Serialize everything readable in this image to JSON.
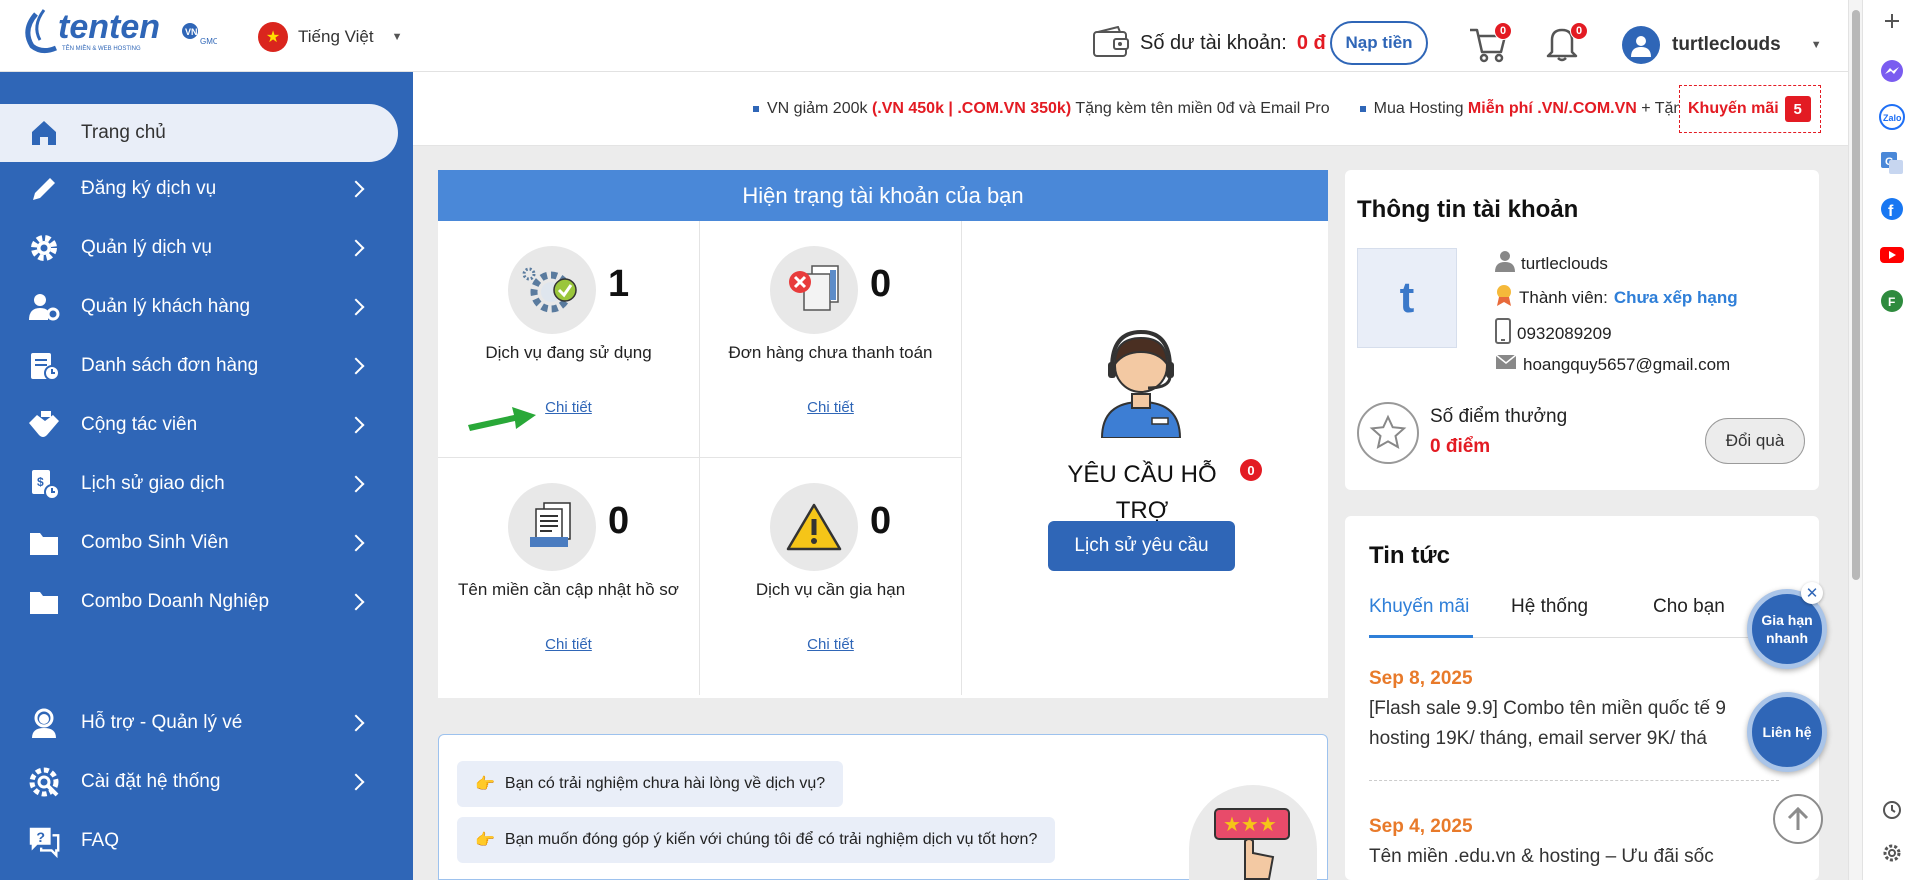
{
  "header": {
    "logo_text": "tenten",
    "logo_sub": "TÊN MIỀN & WEB HOSTING",
    "language": "Tiếng Việt",
    "balance_label": "Số dư tài khoản:",
    "balance_value": "0 đ",
    "topup_label": "Nạp tiền",
    "cart_count": "0",
    "notify_count": "0",
    "username": "turtleclouds"
  },
  "sidebar": {
    "items": [
      {
        "label": "Trang chủ",
        "icon": "home-icon"
      },
      {
        "label": "Đăng ký dịch vụ",
        "icon": "pencil-icon"
      },
      {
        "label": "Quản lý dịch vụ",
        "icon": "gear-icon"
      },
      {
        "label": "Quản lý khách hàng",
        "icon": "user-gear-icon"
      },
      {
        "label": "Danh sách đơn hàng",
        "icon": "order-list-icon"
      },
      {
        "label": "Cộng tác viên",
        "icon": "handshake-icon"
      },
      {
        "label": "Lịch sử giao dịch",
        "icon": "transaction-icon"
      },
      {
        "label": "Combo Sinh Viên",
        "icon": "folder-icon"
      },
      {
        "label": "Combo Doanh Nghiệp",
        "icon": "folder-icon"
      },
      {
        "label": "Hỗ trợ - Quản lý vé",
        "icon": "support-agent-icon"
      },
      {
        "label": "Cài đặt hệ thống",
        "icon": "settings-icon"
      },
      {
        "label": "FAQ",
        "icon": "faq-icon"
      }
    ]
  },
  "promo": {
    "item1_a": "VN giảm 200k ",
    "item1_red": "(.VN 450k | .COM.VN 350k)",
    "item1_b": " Tặng kèm tên miền 0đ và Email Pro",
    "item2_a": "Mua Hosting ",
    "item2_red": "Miễn phí .VN/.COM.VN",
    "item2_b": " + Tặn",
    "button_label": "Khuyến mãi",
    "button_count": "5"
  },
  "status": {
    "title": "Hiện trạng tài khoản của bạn",
    "cells": [
      {
        "count": "1",
        "label": "Dịch vụ đang sử dụng",
        "link": "Chi tiết"
      },
      {
        "count": "0",
        "label": "Đơn hàng chưa thanh toán",
        "link": "Chi tiết"
      },
      {
        "count": "0",
        "label": "Tên miền cần cập nhật hồ sơ",
        "link": "Chi tiết"
      },
      {
        "count": "0",
        "label": "Dịch vụ cần gia hạn",
        "link": "Chi tiết"
      }
    ],
    "support_title": "YÊU CẦU HỖ TRỢ",
    "support_count": "0",
    "support_button": "Lịch sử yêu cầu"
  },
  "feedback": {
    "q1": "Bạn có trải nghiệm chưa hài lòng về dịch vụ?",
    "q2": "Bạn muốn đóng góp ý kiến với chúng tôi để có trải nghiệm dịch vụ tốt hơn?"
  },
  "account": {
    "title": "Thông tin tài khoản",
    "initial": "t",
    "username": "turtleclouds",
    "member_label": "Thành viên:",
    "member_value": "Chưa xếp hạng",
    "phone": "0932089209",
    "email": "hoangquy5657@gmail.com",
    "points_label": "Số điểm thưởng",
    "points_value": "0 điểm",
    "redeem_label": "Đổi quà"
  },
  "news": {
    "title": "Tin tức",
    "tabs": [
      "Khuyến mãi",
      "Hệ thống",
      "Cho bạn"
    ],
    "items": [
      {
        "date": "Sep 8, 2025",
        "line1": "[Flash sale 9.9] Combo tên miền quốc tế 9",
        "line2": "hosting 19K/ tháng, email server 9K/ thá"
      },
      {
        "date": "Sep 4, 2025",
        "line1": "Tên miền .edu.vn & hosting – Ưu đãi sốc",
        "line2": ""
      }
    ]
  },
  "floating": {
    "renew_label": "Gia hạn nhanh",
    "contact_label": "Liên hệ"
  },
  "colors": {
    "primary": "#2f66b7",
    "header_bar": "#4a88d8",
    "accent_red": "#e31b23",
    "news_date": "#e87a2a"
  }
}
